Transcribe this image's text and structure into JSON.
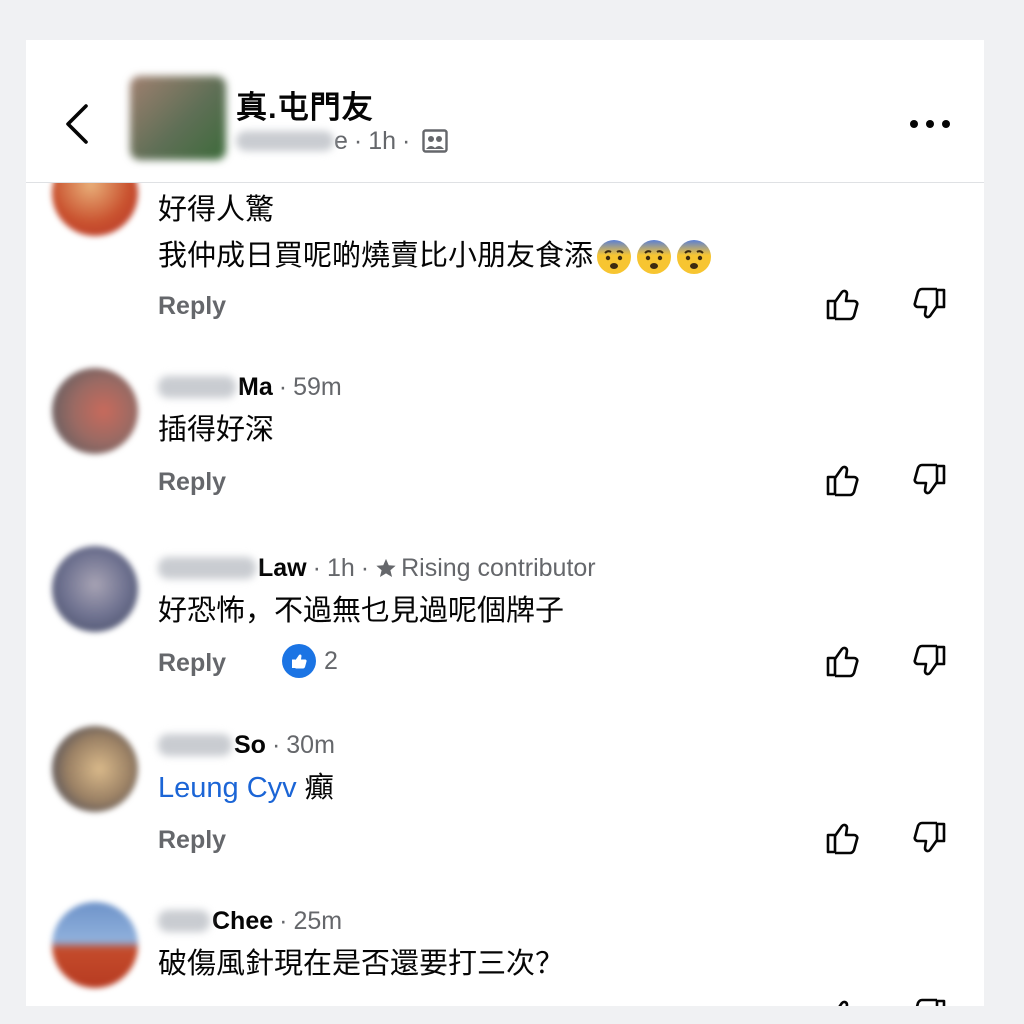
{
  "header": {
    "title": "真.屯門友",
    "author_suffix": "e",
    "time": "1h",
    "dot": "·",
    "back_icon": "chevron-left-icon",
    "more_icon": "more-horizontal-icon",
    "privacy_icon": "public-group-icon"
  },
  "comments": [
    {
      "line1": "好得人驚",
      "line2": "我仲成日買呢啲燒賣比小朋友食添",
      "emoji": [
        "anxious-face-emoji",
        "anxious-face-emoji",
        "anxious-face-emoji"
      ],
      "reply": "Reply"
    },
    {
      "author_last": "Ma",
      "time": "59m",
      "text": "插得好深",
      "reply": "Reply"
    },
    {
      "author_last": "Law",
      "time": "1h",
      "badge": "Rising contributor",
      "text": "好恐怖，不過無乜見過呢個牌子",
      "reply": "Reply",
      "likes": "2"
    },
    {
      "author_last": "So",
      "time": "30m",
      "mention": "Leung Cyv",
      "text": "癲",
      "reply": "Reply"
    },
    {
      "author_last": "Chee",
      "time": "25m",
      "text": "破傷風針現在是否還要打三次？"
    }
  ],
  "colors": {
    "link": "#1b65d6",
    "secondary_text": "#65676b",
    "like_blue": "#1b74e4",
    "emoji_yellow": "#f7c531"
  }
}
